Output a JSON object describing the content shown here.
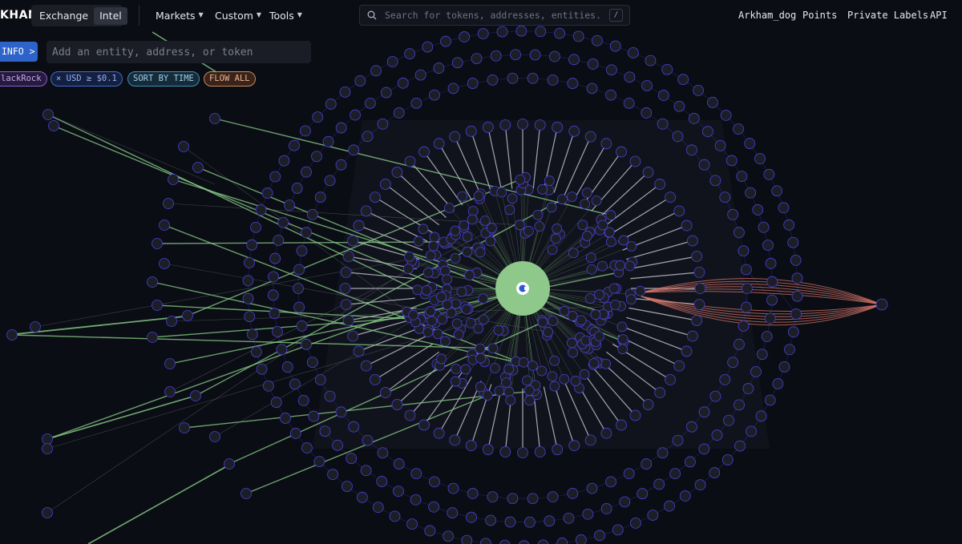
{
  "nav": {
    "brand": "KHAM",
    "modes": [
      "Exchange",
      "Intel"
    ],
    "active_mode": "Intel",
    "menus": [
      "Markets",
      "Custom",
      "Tools"
    ],
    "search_placeholder": "Search for tokens, addresses, entities...",
    "search_shortcut": "/",
    "right_links": [
      "Arkham_dog",
      "Points",
      "Private Labels",
      "API"
    ]
  },
  "toolbar": {
    "info_label": "INFO",
    "info_arrow": ">",
    "entity_placeholder": "Add an entity, address, or token"
  },
  "filters": {
    "entity_chip": "lackRock",
    "usd_chip": "× USD ≥ $0.1",
    "sort_chip": "SORT BY TIME",
    "flow_chip": "FLOW ALL"
  },
  "graph": {
    "center_icon": "coinbase-logo",
    "colors": {
      "background": "#0b0d14",
      "node_fill": "#1c1e26",
      "node_ring": "#4a3fd6",
      "edge_inflow": "#8bd18b",
      "edge_neutral": "#c9ccd4",
      "edge_outflow": "#d9776a",
      "center_fill": "#8ec98b"
    }
  }
}
